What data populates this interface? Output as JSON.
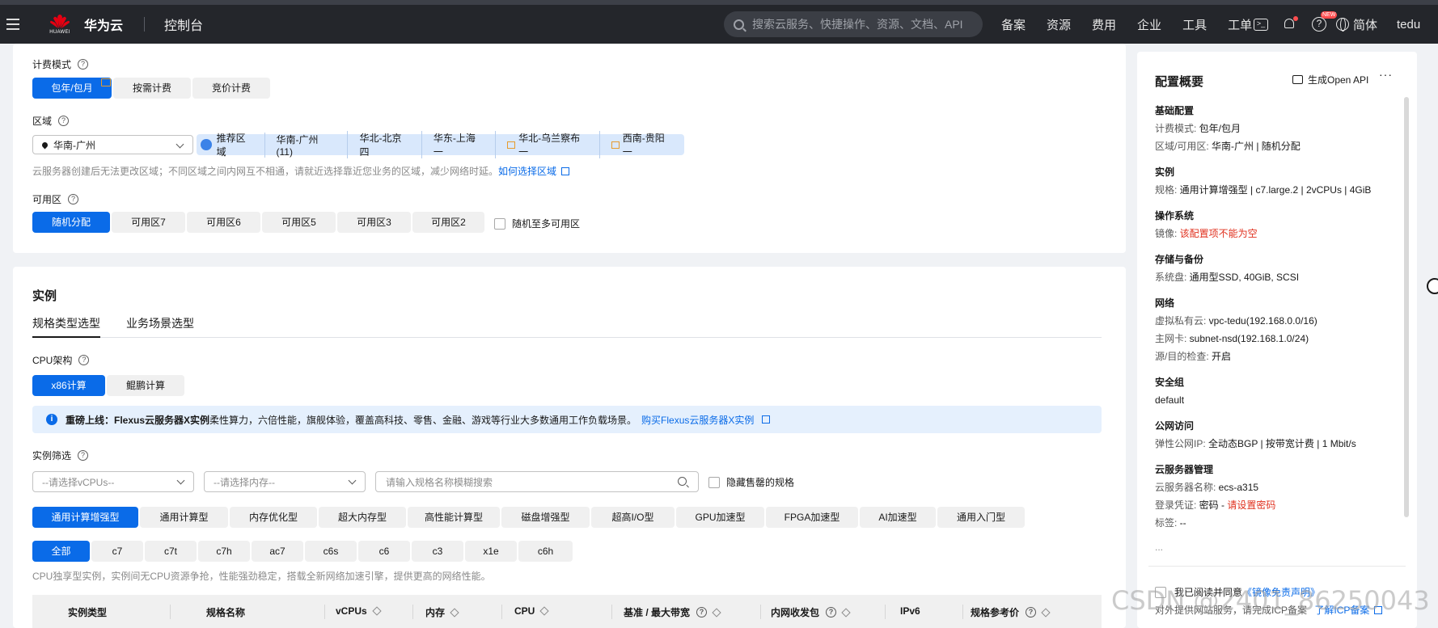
{
  "topbar": {
    "brand_logo_text": "HUAWEI",
    "brand": "华为云",
    "console": "控制台",
    "search_placeholder": "搜索云服务、快捷操作、资源、文档、API",
    "nav": [
      "备案",
      "资源",
      "费用",
      "企业",
      "工具",
      "工单"
    ],
    "new_badge": "NEW",
    "lang": "简体",
    "user": "tedu"
  },
  "billing": {
    "label": "计费模式",
    "options": [
      "包年/包月",
      "按需计费",
      "竞价计费"
    ],
    "selected": "包年/包月"
  },
  "region": {
    "label": "区域",
    "selected": "华南-广州",
    "recommend_label": "推荐区域",
    "recommend": [
      "华南-广州 (11)",
      "华北-北京四",
      "华东-上海一",
      "华北-乌兰察布一",
      "西南-贵阳一"
    ],
    "hint": "云服务器创建后无法更改区域；不同区域之间内网互不相通，请就近选择靠近您业务的区域，减少网络时延。",
    "hint_link": "如何选择区域"
  },
  "az": {
    "label": "可用区",
    "options": [
      "随机分配",
      "可用区7",
      "可用区6",
      "可用区5",
      "可用区3",
      "可用区2"
    ],
    "selected": "随机分配",
    "multi_az": "随机至多可用区"
  },
  "instance": {
    "title": "实例",
    "tabs": [
      "规格类型选型",
      "业务场景选型"
    ],
    "active_tab": "规格类型选型",
    "cpu_arch_label": "CPU架构",
    "cpu_arch": [
      "x86计算",
      "鲲鹏计算"
    ],
    "cpu_arch_selected": "x86计算",
    "notice_bold": "重磅上线：Flexus云服务器X实例",
    "notice_text": " 柔性算力，六倍性能，旗舰体验，覆盖高科技、零售、金融、游戏等行业大多数通用工作负载场景。",
    "notice_link": "购买Flexus云服务器X实例",
    "filter_label": "实例筛选",
    "vcpu_placeholder": "--请选择vCPUs--",
    "mem_placeholder": "--请选择内存--",
    "name_placeholder": "请输入规格名称模糊搜索",
    "hide_sold_out": "隐藏售罄的规格",
    "families": [
      "通用计算增强型",
      "通用计算型",
      "内存优化型",
      "超大内存型",
      "高性能计算型",
      "磁盘增强型",
      "超高I/O型",
      "GPU加速型",
      "FPGA加速型",
      "AI加速型",
      "通用入门型"
    ],
    "family_selected": "通用计算增强型",
    "series": [
      "全部",
      "c7",
      "c7t",
      "c7h",
      "ac7",
      "c6s",
      "c6",
      "c3",
      "x1e",
      "c6h"
    ],
    "series_selected": "全部",
    "series_hint": "CPU独享型实例，实例间无CPU资源争抢，性能强劲稳定，搭载全新网络加速引擎，提供更高的网络性能。",
    "table_headers": [
      "实例类型",
      "规格名称",
      "vCPUs",
      "内存",
      "CPU",
      "基准 / 最大带宽",
      "内网收发包",
      "IPv6",
      "规格参考价"
    ]
  },
  "summary": {
    "title": "配置概要",
    "open_api": "生成Open API",
    "more": "···",
    "groups": [
      {
        "title": "基础配置",
        "rows": [
          {
            "k": "计费模式: ",
            "v": "包年/包月"
          },
          {
            "k": "区域/可用区: ",
            "v": "华南-广州 | 随机分配"
          }
        ]
      },
      {
        "title": "实例",
        "rows": [
          {
            "k": "规格: ",
            "v": "通用计算增强型 | c7.large.2 | 2vCPUs | 4GiB"
          }
        ]
      },
      {
        "title": "操作系统",
        "rows": [
          {
            "k": "镜像: ",
            "v": "该配置项不能为空",
            "err": true
          }
        ]
      },
      {
        "title": "存储与备份",
        "rows": [
          {
            "k": "系统盘: ",
            "v": "通用型SSD, 40GiB, SCSI"
          }
        ]
      },
      {
        "title": "网络",
        "rows": [
          {
            "k": "虚拟私有云: ",
            "v": "vpc-tedu(192.168.0.0/16)"
          },
          {
            "k": "主网卡: ",
            "v": "subnet-nsd(192.168.1.0/24)"
          },
          {
            "k": "源/目的检查: ",
            "v": "开启"
          }
        ]
      },
      {
        "title": "安全组",
        "rows": [
          {
            "k": "",
            "v": "default"
          }
        ]
      },
      {
        "title": "公网访问",
        "rows": [
          {
            "k": "弹性公网IP: ",
            "v": "全动态BGP | 按带宽计费 | 1 Mbit/s"
          }
        ]
      },
      {
        "title": "云服务器管理",
        "rows": [
          {
            "k": "云服务器名称: ",
            "v": "ecs-a315"
          },
          {
            "k": "登录凭证: ",
            "v": "密码 - "
          },
          {
            "k": "标签: ",
            "v": "--"
          }
        ]
      }
    ],
    "password_link": "请设置密码",
    "ellipsis": "...",
    "agree_text": "我已阅读并同意",
    "agree_link": "《镜像免责声明》",
    "agree_line2": "对外提供网站服务，请完成ICP备案",
    "icp_link": "了解ICP备案"
  },
  "watermark": "CSDN @2401_86250043"
}
